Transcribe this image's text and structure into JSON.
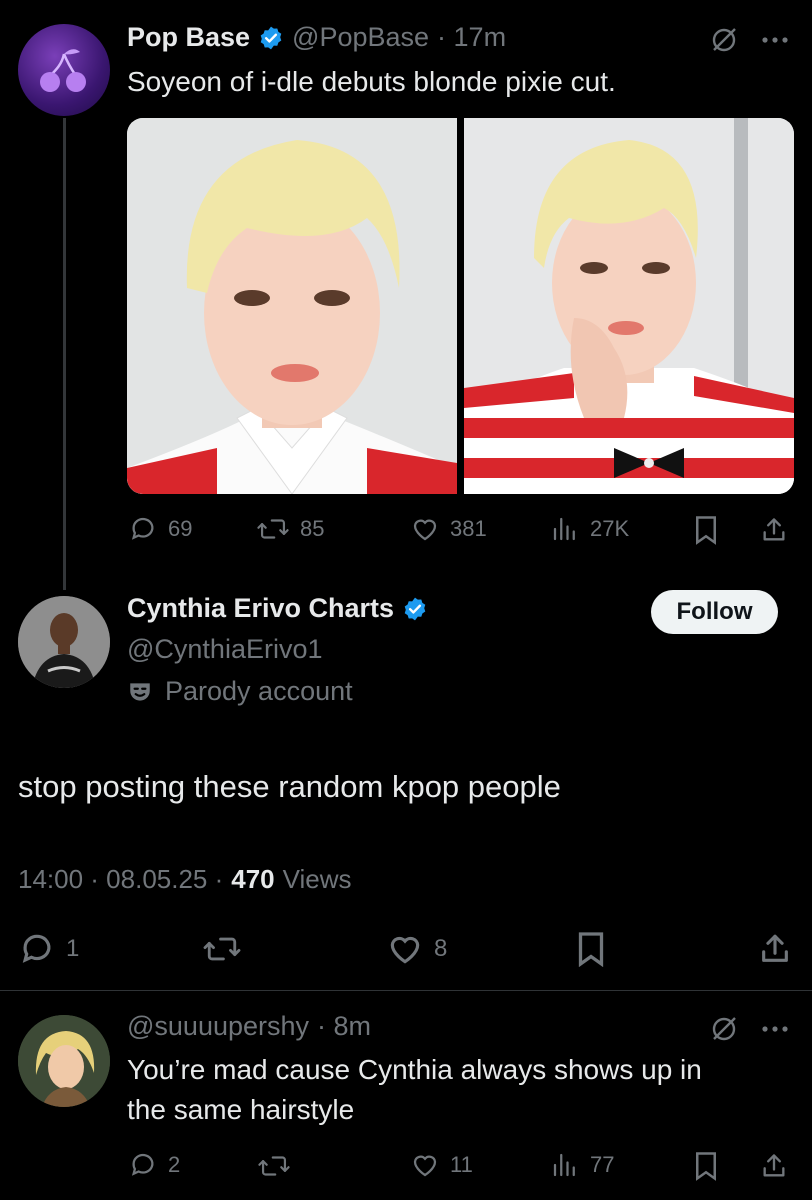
{
  "post1": {
    "author_name": "Pop Base",
    "handle": "@PopBase",
    "time": "· 17m",
    "text": "Soyeon of i-dle debuts blonde pixie cut.",
    "replies": "69",
    "reposts": "85",
    "likes": "381",
    "views": "27K"
  },
  "post2": {
    "author_name": "Cynthia Erivo Charts",
    "handle": "@CynthiaErivo1",
    "parody_label": "Parody account",
    "follow_label": "Follow",
    "text": "stop posting these random kpop people",
    "meta_time": "14:00 · 08.05.25 ·",
    "views_count": "470",
    "views_label": "Views",
    "replies": "1",
    "likes": "8"
  },
  "post3": {
    "handle": "@suuuupershy",
    "time": "· 8m",
    "text_line1": "You’re mad cause Cynthia always shows up in",
    "text_line2": "the same hairstyle",
    "replies": "2",
    "likes": "11",
    "views": "77"
  },
  "icons": [
    "reply-icon",
    "repost-icon",
    "like-icon",
    "views-icon",
    "bookmark-icon",
    "share-icon",
    "more-icon",
    "grok-icon",
    "verified-badge-icon",
    "parody-mask-icon"
  ],
  "colors": {
    "verified": "#1d9bf0",
    "background": "#000000",
    "text": "#e7e9ea",
    "muted": "#71767b"
  }
}
